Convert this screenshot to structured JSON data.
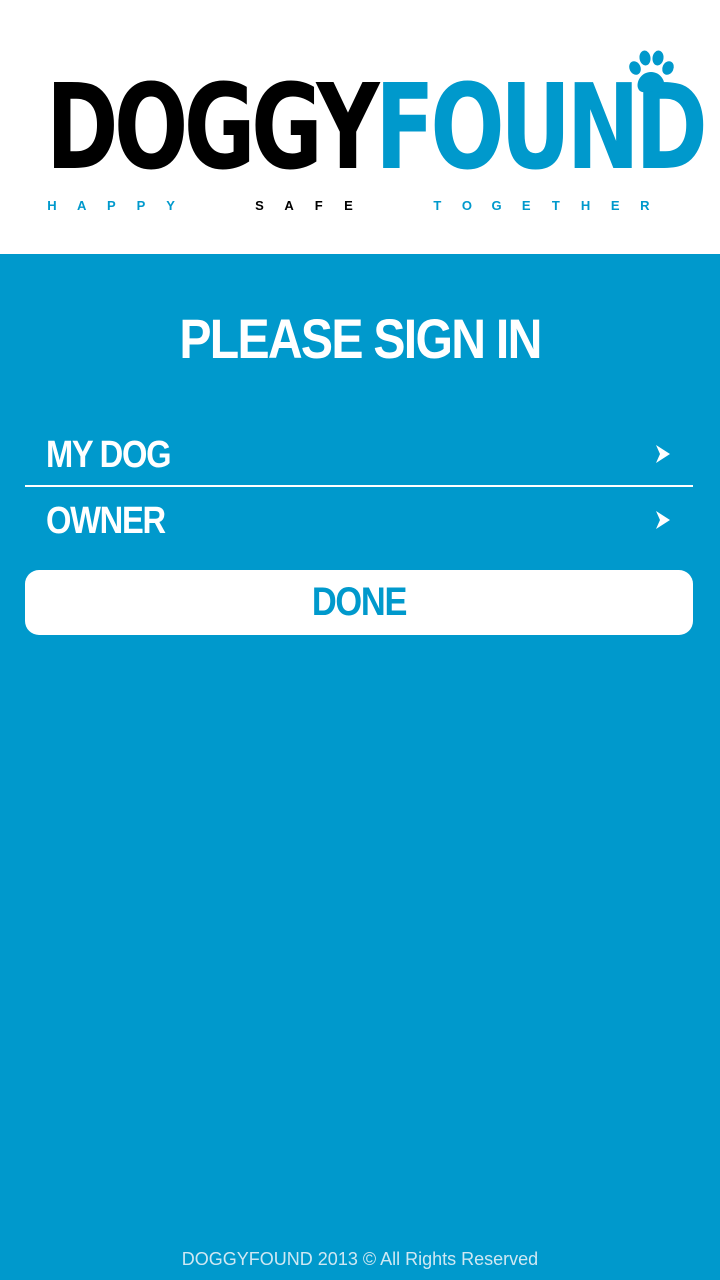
{
  "header": {
    "logo": {
      "part_dark": "DOGGY",
      "part_blue": "FOUND",
      "icon": "paw-icon"
    },
    "tagline": {
      "word1": "HAPPY",
      "word2": "SAFE",
      "word3": "TOGETHER"
    }
  },
  "main": {
    "title": "PLEASE SIGN IN",
    "items": [
      {
        "label": "MY DOG",
        "icon": "chevron-right-icon"
      },
      {
        "label": "OWNER",
        "icon": "chevron-right-icon"
      }
    ],
    "done_label": "DONE"
  },
  "footer": {
    "text": "DOGGYFOUND 2013 © All Rights Reserved"
  },
  "colors": {
    "brand_blue": "#0099cc",
    "white": "#ffffff",
    "logo_dark": "#000000"
  }
}
